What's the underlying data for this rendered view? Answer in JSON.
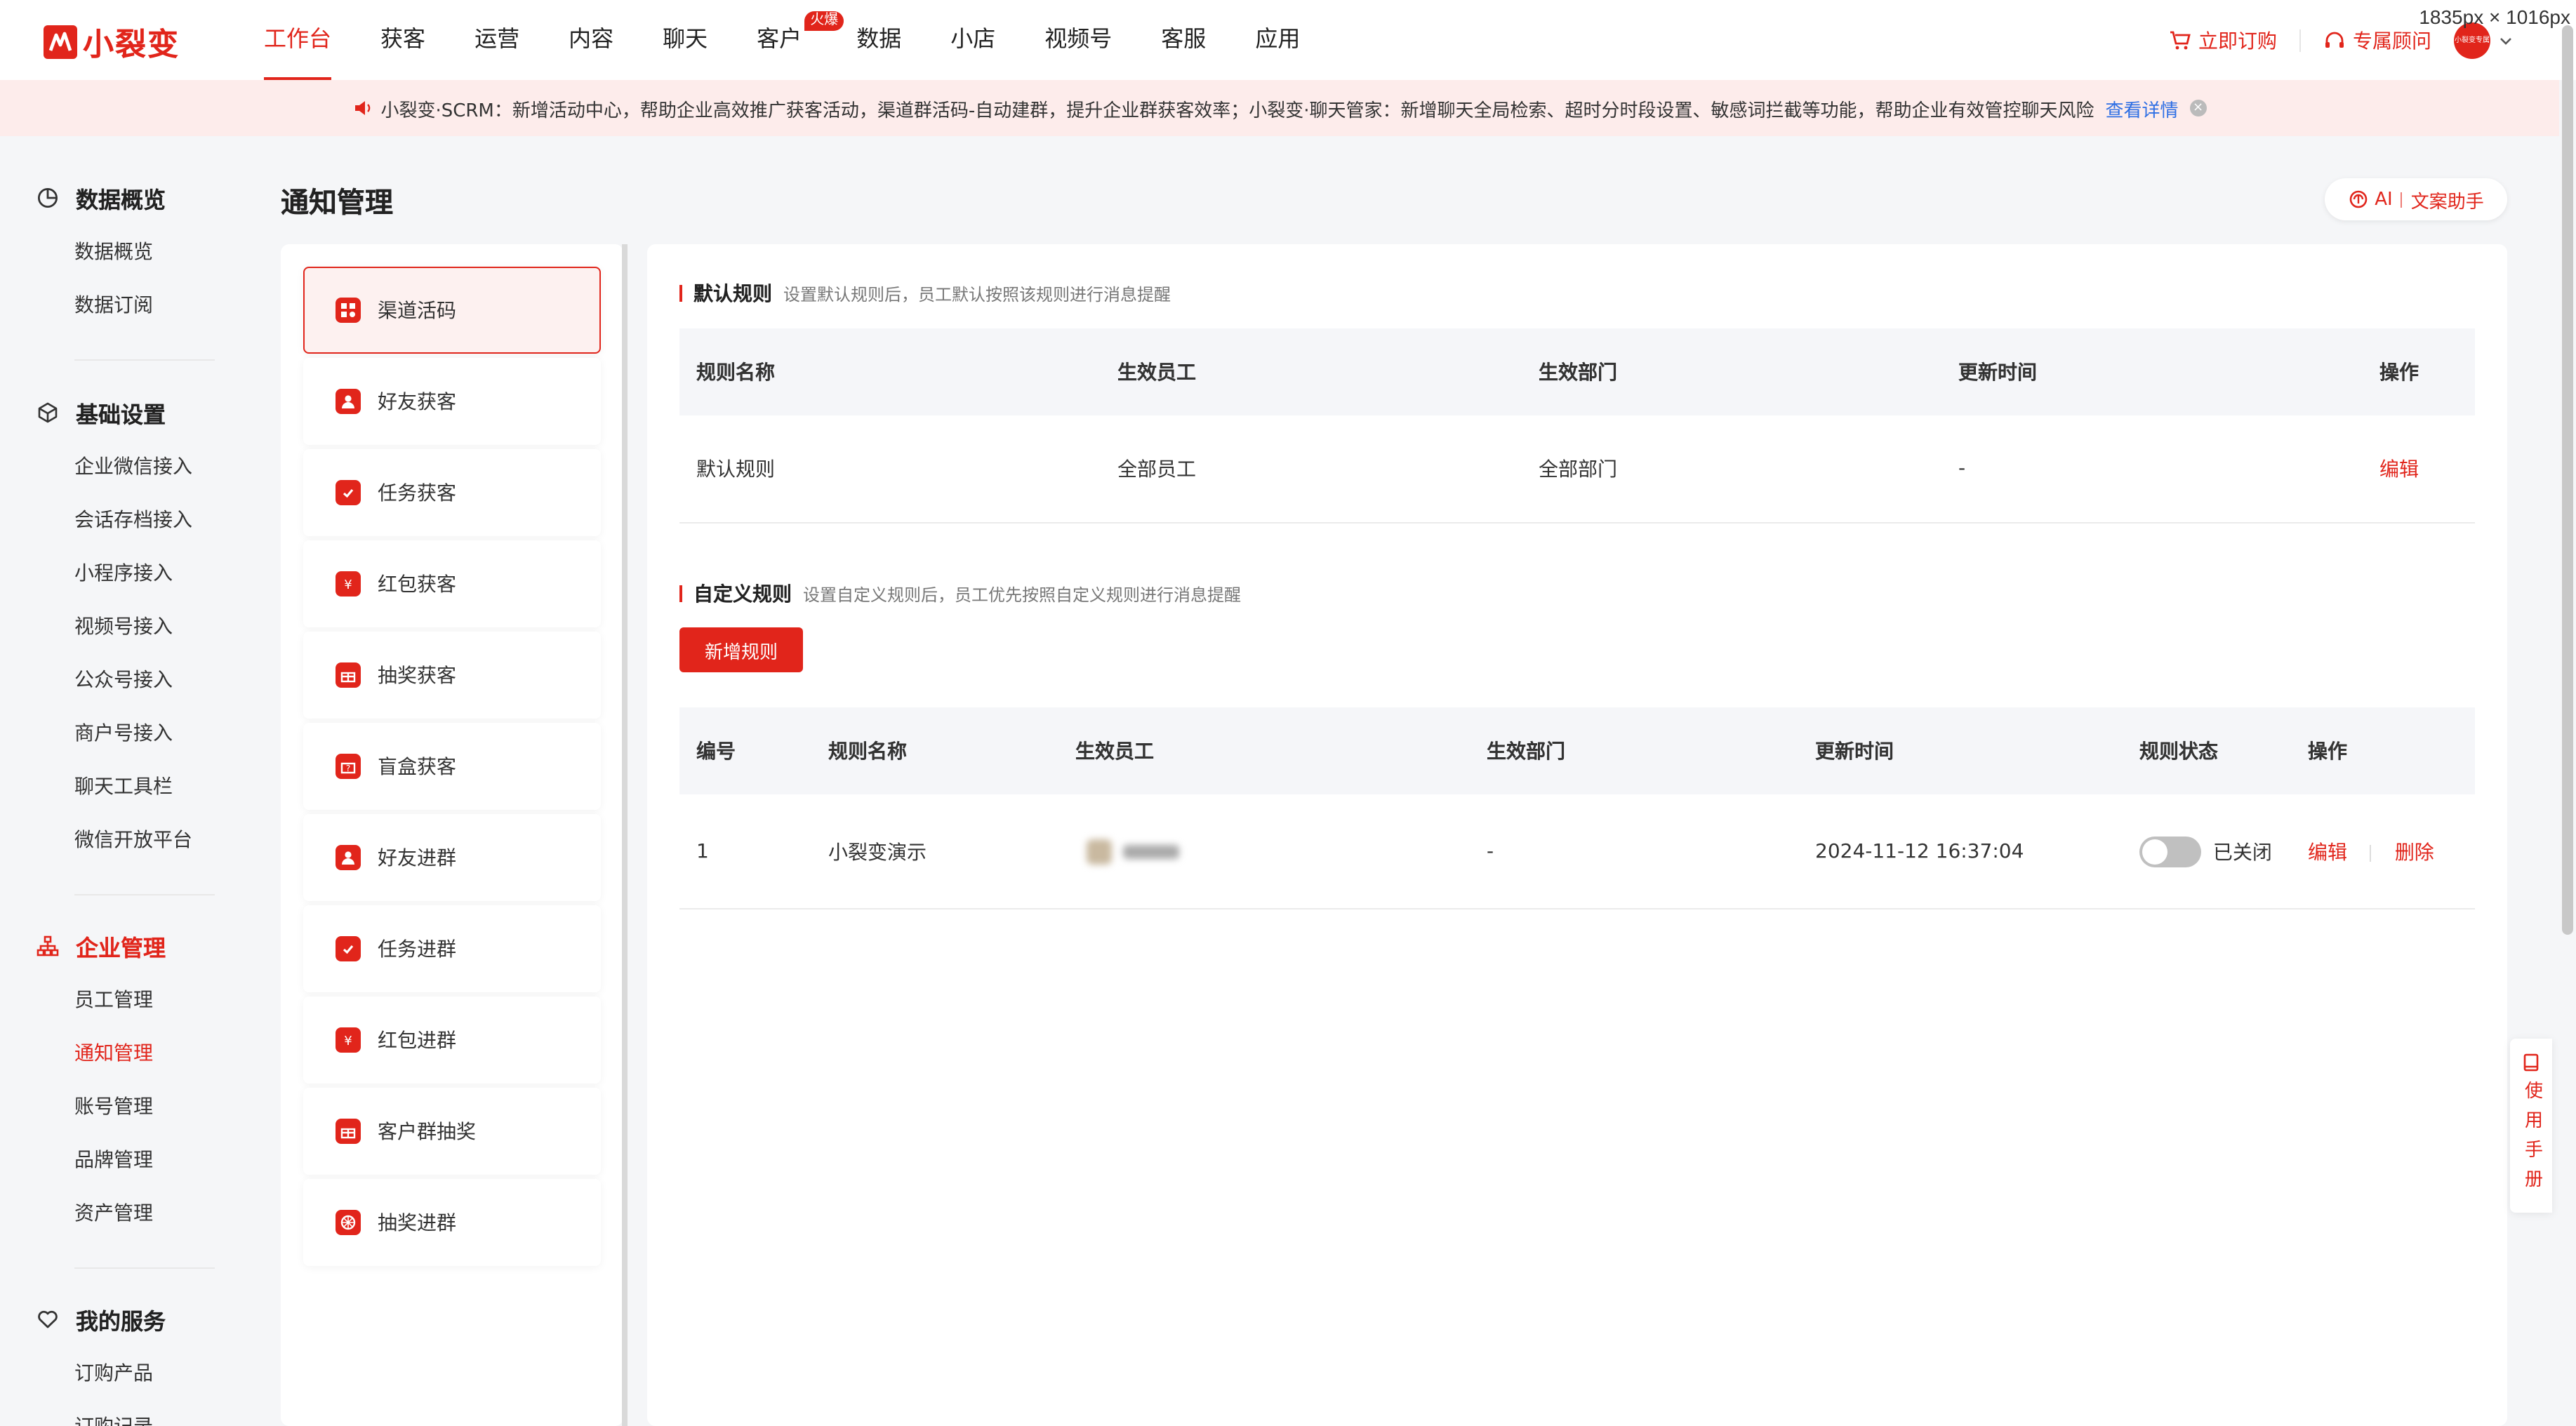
{
  "app": {
    "brand": "小裂变",
    "dimensions_label": "1835px × 1016px"
  },
  "topnav": {
    "items": [
      {
        "label": "工作台",
        "active": true
      },
      {
        "label": "获客"
      },
      {
        "label": "运营"
      },
      {
        "label": "内容"
      },
      {
        "label": "聊天"
      },
      {
        "label": "客户",
        "badge": "火爆"
      },
      {
        "label": "数据"
      },
      {
        "label": "小店"
      },
      {
        "label": "视频号"
      },
      {
        "label": "客服"
      },
      {
        "label": "应用"
      }
    ],
    "subscribe_label": "立即订购",
    "advisor_label": "专属顾问",
    "avatar_text": "小裂变专属"
  },
  "notice": {
    "text": "小裂变·SCRM：新增活动中心，帮助企业高效推广获客活动，渠道群活码-自动建群，提升企业群获客效率；小裂变·聊天管家：新增聊天全局检索、超时分时段设置、敏感词拦截等功能，帮助企业有效管控聊天风险",
    "link": "查看详情"
  },
  "sidebar": {
    "groups": [
      {
        "title": "数据概览",
        "items": [
          "数据概览",
          "数据订阅"
        ]
      },
      {
        "title": "基础设置",
        "items": [
          "企业微信接入",
          "会话存档接入",
          "小程序接入",
          "视频号接入",
          "公众号接入",
          "商户号接入",
          "聊天工具栏",
          "微信开放平台"
        ]
      },
      {
        "title": "企业管理",
        "items": [
          "员工管理",
          "通知管理",
          "账号管理",
          "品牌管理",
          "资产管理"
        ]
      },
      {
        "title": "我的服务",
        "items": [
          "订购产品",
          "订购记录"
        ]
      }
    ]
  },
  "page": {
    "title": "通知管理",
    "ai_label_a": "AI",
    "ai_label_b": "文案助手"
  },
  "types": [
    "渠道活码",
    "好友获客",
    "任务获客",
    "红包获客",
    "抽奖获客",
    "盲盒获客",
    "好友进群",
    "任务进群",
    "红包进群",
    "客户群抽奖",
    "抽奖进群"
  ],
  "default_rules": {
    "title": "默认规则",
    "desc": "设置默认规则后，员工默认按照该规则进行消息提醒",
    "headers": [
      "规则名称",
      "生效员工",
      "生效部门",
      "更新时间",
      "操作"
    ],
    "row": {
      "name": "默认规则",
      "staff": "全部员工",
      "dept": "全部部门",
      "time": "-",
      "action": "编辑"
    }
  },
  "custom_rules": {
    "title": "自定义规则",
    "desc": "设置自定义规则后，员工优先按照自定义规则进行消息提醒",
    "add_button": "新增规则",
    "headers": [
      "编号",
      "规则名称",
      "生效员工",
      "生效部门",
      "更新时间",
      "规则状态",
      "操作"
    ],
    "rows": [
      {
        "id": "1",
        "name": "小裂变演示",
        "dept": "-",
        "time": "2024-11-12 16:37:04",
        "status": "已关闭",
        "edit": "编辑",
        "delete": "删除"
      }
    ]
  },
  "manual": {
    "label": "使用手册"
  },
  "colors": {
    "accent": "#e1251b",
    "link": "#2f6fe4",
    "notice_bg": "#fdeceb"
  }
}
